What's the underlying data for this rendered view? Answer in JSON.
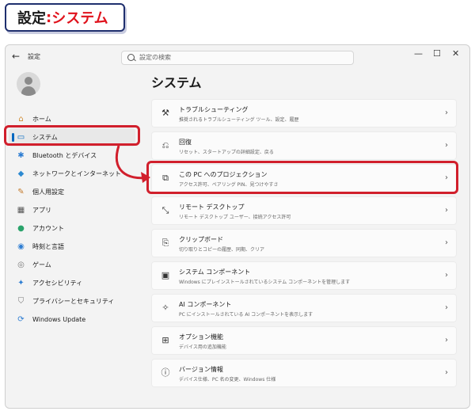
{
  "caption": {
    "part1": "設定",
    "sep": ":",
    "part2": "システム"
  },
  "window": {
    "title": "設定",
    "back_icon": "←",
    "search_placeholder": "設定の検索",
    "controls": {
      "minimize": "—",
      "maximize": "☐",
      "close": "✕"
    }
  },
  "sidebar": {
    "items": [
      {
        "label": "ホーム",
        "icon": "⌂",
        "color": "#d08a2e"
      },
      {
        "label": "システム",
        "icon": "▭",
        "color": "#0067c0"
      },
      {
        "label": "Bluetooth とデバイス",
        "icon": "✱",
        "color": "#2d7dd2"
      },
      {
        "label": "ネットワークとインターネット",
        "icon": "◆",
        "color": "#2d8ad1"
      },
      {
        "label": "個人用設定",
        "icon": "✎",
        "color": "#c47a2a"
      },
      {
        "label": "アプリ",
        "icon": "▦",
        "color": "#555555"
      },
      {
        "label": "アカウント",
        "icon": "●",
        "color": "#2aa36b"
      },
      {
        "label": "時刻と言語",
        "icon": "◉",
        "color": "#2d7dd2"
      },
      {
        "label": "ゲーム",
        "icon": "◎",
        "color": "#777777"
      },
      {
        "label": "アクセシビリティ",
        "icon": "✦",
        "color": "#2d7dd2"
      },
      {
        "label": "プライバシーとセキュリティ",
        "icon": "⛉",
        "color": "#777777"
      },
      {
        "label": "Windows Update",
        "icon": "⟳",
        "color": "#2d7dd2"
      }
    ]
  },
  "main": {
    "title": "システム",
    "items": [
      {
        "title": "トラブルシューティング",
        "sub": "推奨されるトラブルシューティング ツール、設定、履歴",
        "icon": "⚒"
      },
      {
        "title": "回復",
        "sub": "リセット、スタートアップの詳細設定、戻る",
        "icon": "⎌"
      },
      {
        "title": "この PC へのプロジェクション",
        "sub": "アクセス許可、ペアリング PIN、見つけやすさ",
        "icon": "⧉"
      },
      {
        "title": "リモート デスクトップ",
        "sub": "リモート デスクトップ ユーザー、接続アクセス許可",
        "icon": "⤡"
      },
      {
        "title": "クリップボード",
        "sub": "切り取りとコピーの履歴、同期、クリア",
        "icon": "⎘"
      },
      {
        "title": "システム コンポーネント",
        "sub": "Windows にプレインストールされているシステム コンポーネントを管理します",
        "icon": "▣"
      },
      {
        "title": "AI コンポーネント",
        "sub": "PC にインストールされている AI コンポーネントを表示します",
        "icon": "✧"
      },
      {
        "title": "オプション機能",
        "sub": "デバイス用の追加機能",
        "icon": "⊞"
      },
      {
        "title": "バージョン情報",
        "sub": "デバイス仕様、PC 名の変更、Windows 仕様",
        "icon": "ⓘ"
      }
    ],
    "chevron": "›"
  },
  "annotation_color": "#d11f2c"
}
